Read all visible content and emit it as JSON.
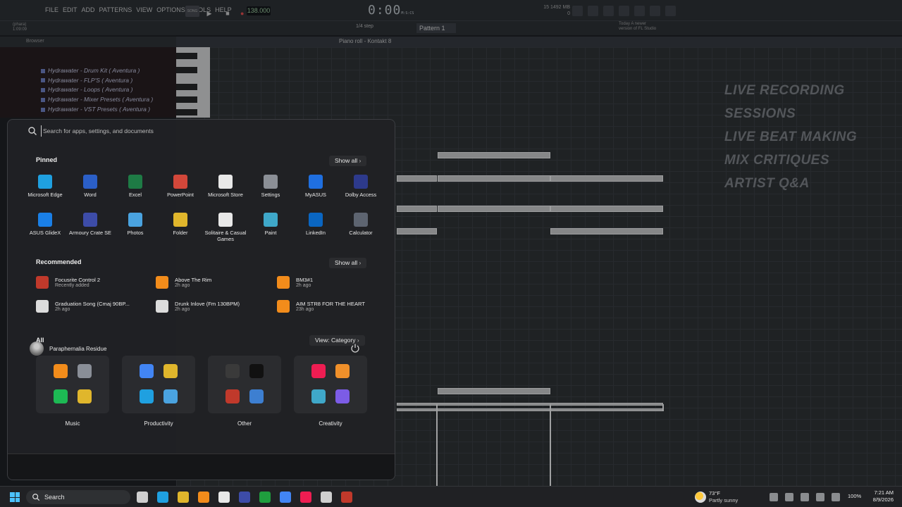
{
  "fl": {
    "menu": [
      "FILE",
      "EDIT",
      "ADD",
      "PATTERNS",
      "VIEW",
      "OPTIONS",
      "TOOLS",
      "HELP"
    ],
    "song_label": "SONG",
    "tempo": "138.000",
    "time": "0:00",
    "time_suffix": "M:S:CS",
    "cpu_line1": "15   1492 MB",
    "cpu_line2": "0",
    "project_line1": "(phara)",
    "project_line2": "1:09:09",
    "step": "1/4 step",
    "pattern": "Pattern 1",
    "news_line1": "Today  A newer",
    "news_line2": "version of FL Studio",
    "browser_title": "Browser",
    "piano_roll_title": "Piano roll - Kontakt 8",
    "browser_items": [
      "Hydrawater - Drum Kit ( Aventura )",
      "Hydrawater - FLP'S ( Aventura )",
      "Hydrawater - Loops ( Aventura )",
      "Hydrawater - Mixer Presets ( Aventura )",
      "Hydrawater - VST Presets ( Aventura )"
    ],
    "promo": [
      "LIVE RECORDING SESSIONS",
      "LIVE BEAT MAKING",
      "MIX CRITIQUES",
      "ARTIST Q&A"
    ]
  },
  "start": {
    "search_placeholder": "Search for apps, settings, and documents",
    "pinned_title": "Pinned",
    "pinned_show_all": "Show all",
    "pinned": [
      {
        "label": "Microsoft Edge",
        "icon": "edge-icon",
        "color": "#1fa0e0"
      },
      {
        "label": "Word",
        "icon": "word-icon",
        "color": "#2b5fc7"
      },
      {
        "label": "Excel",
        "icon": "excel-icon",
        "color": "#1e7b45"
      },
      {
        "label": "PowerPoint",
        "icon": "powerpoint-icon",
        "color": "#d2473a"
      },
      {
        "label": "Microsoft Store",
        "icon": "store-icon",
        "color": "#e8e8e8"
      },
      {
        "label": "Settings",
        "icon": "settings-gear-icon",
        "color": "#8b8f96"
      },
      {
        "label": "MyASUS",
        "icon": "myasus-icon",
        "color": "#1f6fe0"
      },
      {
        "label": "Dolby Access",
        "icon": "dolby-icon",
        "color": "#2d3a8c"
      },
      {
        "label": "ASUS GlideX",
        "icon": "glidex-icon",
        "color": "#1a7fe6"
      },
      {
        "label": "Armoury Crate SE",
        "icon": "armoury-crate-icon",
        "color": "#3d4ca8"
      },
      {
        "label": "Photos",
        "icon": "photos-icon",
        "color": "#4aa3e0"
      },
      {
        "label": "Folder",
        "icon": "folder-icon",
        "color": "#e0b62c"
      },
      {
        "label": "Solitaire & Casual Games",
        "icon": "solitaire-icon",
        "color": "#e8e8e8"
      },
      {
        "label": "Paint",
        "icon": "paint-icon",
        "color": "#3fa8c9"
      },
      {
        "label": "LinkedIn",
        "icon": "linkedin-icon",
        "color": "#0a66c2"
      },
      {
        "label": "Calculator",
        "icon": "calculator-icon",
        "color": "#5d6470"
      }
    ],
    "recommended_title": "Recommended",
    "recommended_show_all": "Show all",
    "recommended": [
      {
        "name": "Focusrite Control 2",
        "time": "Recently added",
        "icon": "focusrite-icon",
        "color": "#c0392b"
      },
      {
        "name": "Above The Rim",
        "time": "2h ago",
        "icon": "fl-studio-icon",
        "color": "#f28c1b"
      },
      {
        "name": "BM3#1",
        "time": "2h ago",
        "icon": "fl-studio-icon",
        "color": "#f28c1b"
      },
      {
        "name": "Graduation Song (Cmaj 90BP...",
        "time": "2h ago",
        "icon": "audio-file-icon",
        "color": "#dcdcdc"
      },
      {
        "name": "Drunk Inlove (Fm 130BPM)",
        "time": "2h ago",
        "icon": "audio-file-icon",
        "color": "#dcdcdc"
      },
      {
        "name": "AIM STR8 FOR THE HEART",
        "time": "23h ago",
        "icon": "fl-studio-icon",
        "color": "#f28c1b"
      }
    ],
    "all_title": "All",
    "view_label": "View: Category",
    "groups": [
      {
        "label": "Music",
        "icons": [
          [
            "fl-studio-icon",
            "#f28c1b"
          ],
          [
            "media-player-icon",
            "#8a8f98"
          ],
          [
            "spotify-icon",
            "#1db954"
          ],
          [
            "folder-icon",
            "#e0b62c"
          ]
        ]
      },
      {
        "label": "Productivity",
        "icons": [
          [
            "chrome-icon",
            "#4285f4"
          ],
          [
            "file-explorer-icon",
            "#e0b62c"
          ],
          [
            "edge-icon",
            "#1fa0e0"
          ],
          [
            "store-icon",
            "#4aa3e0"
          ]
        ]
      },
      {
        "label": "Other",
        "icons": [
          [
            "obs-icon",
            "#3a3a3a"
          ],
          [
            "call-of-duty-icon",
            "#111111"
          ],
          [
            "focusrite-icon",
            "#c0392b"
          ],
          [
            "games-icon",
            "#3d7fd1"
          ]
        ]
      },
      {
        "label": "Creativity",
        "icons": [
          [
            "tiktok-icon",
            "#ee1d52"
          ],
          [
            "blender-icon",
            "#f0902a"
          ],
          [
            "paint-icon",
            "#3fa8c9"
          ],
          [
            "clipchamp-icon",
            "#7c5ce6"
          ]
        ]
      }
    ],
    "user_name": "Paraphernalia Residue"
  },
  "taskbar": {
    "search_label": "Search",
    "apps": [
      [
        "task-view-icon",
        "#cfcfcf"
      ],
      [
        "edge-icon",
        "#1fa0e0"
      ],
      [
        "file-explorer-icon",
        "#e0b62c"
      ],
      [
        "fl-studio-icon",
        "#f28c1b"
      ],
      [
        "store-icon",
        "#e8e8e8"
      ],
      [
        "armoury-crate-icon",
        "#3d4ca8"
      ],
      [
        "xbox-icon",
        "#1f9e3e"
      ],
      [
        "chrome-icon",
        "#4285f4"
      ],
      [
        "tiktok-icon",
        "#ee1d52"
      ],
      [
        "obs-icon",
        "#cfcfcf"
      ],
      [
        "focusrite-icon",
        "#c0392b"
      ]
    ],
    "weather_temp": "73°F",
    "weather_desc": "Partly sunny",
    "battery": "100%",
    "time": "7:21 AM",
    "date": "8/9/2026"
  }
}
